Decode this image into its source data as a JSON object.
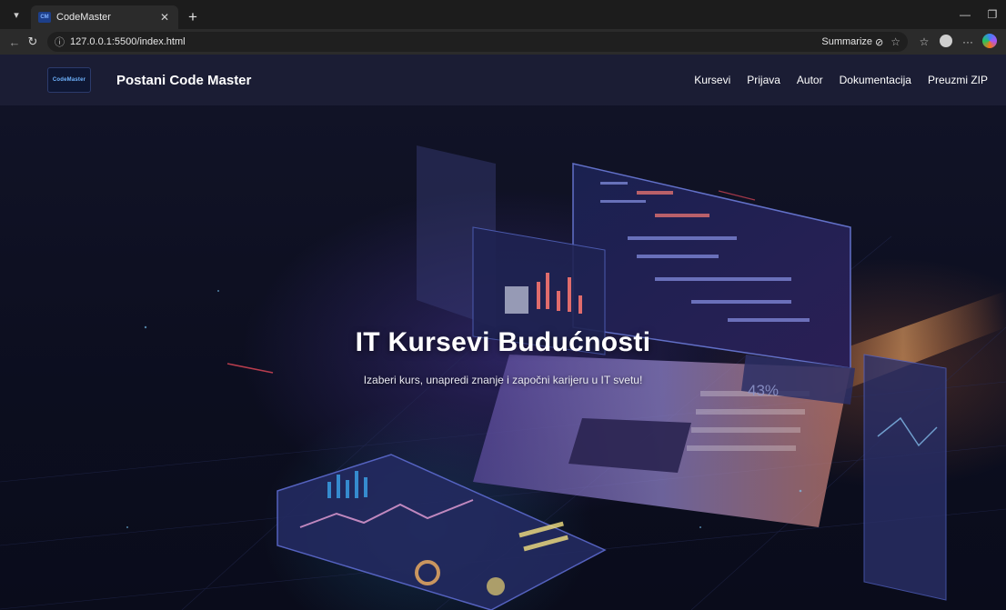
{
  "browser": {
    "tab_title": "CodeMaster",
    "favicon_text": "CM",
    "url": "127.0.0.1:5500/index.html",
    "summarize_label": "Summarize"
  },
  "site": {
    "logo_text": "CodeMaster",
    "brand": "Postani Code Master",
    "menu": [
      {
        "label": "Kursevi"
      },
      {
        "label": "Prijava"
      },
      {
        "label": "Autor"
      },
      {
        "label": "Dokumentacija"
      },
      {
        "label": "Preuzmi ZIP"
      }
    ]
  },
  "hero": {
    "title": "IT Kursevi Budućnosti",
    "subtitle": "Izaberi kurs, unapredi znanje i započni karijeru u IT svetu!",
    "badge": "43%"
  },
  "colors": {
    "nav_bg": "#1b1d34",
    "page_bg": "#0d0f1f",
    "accent": "#6fb4ff"
  }
}
